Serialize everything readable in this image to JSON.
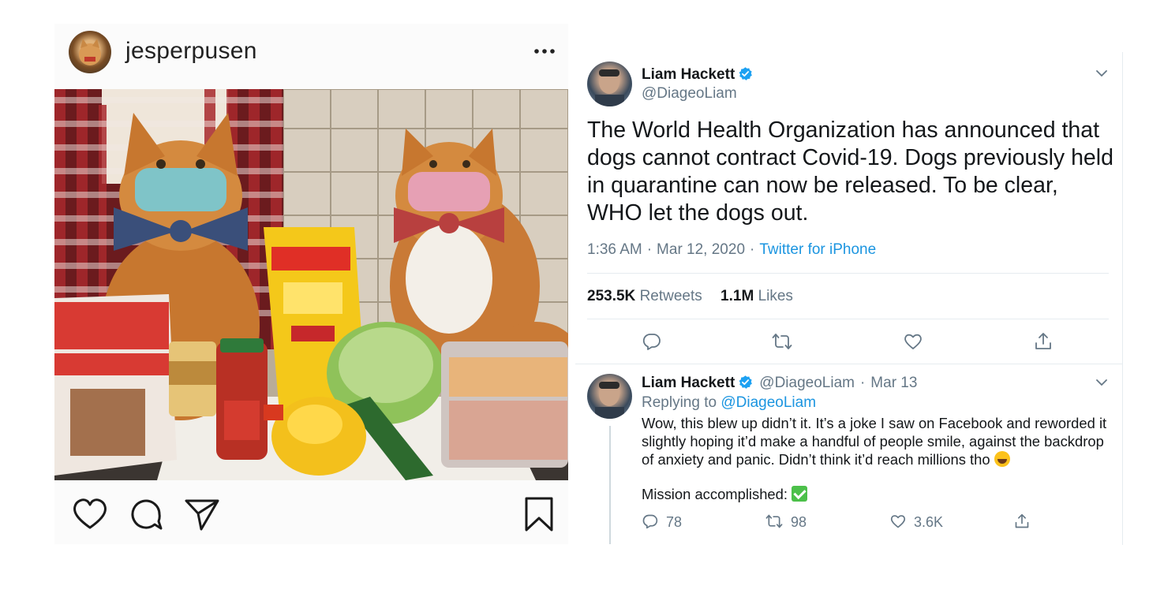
{
  "instagram": {
    "username": "jesperpusen"
  },
  "tweet": {
    "name": "Liam Hackett",
    "handle": "@DiageoLiam",
    "text": "The World Health Organization has announced that dogs cannot contract Covid-19. Dogs previously held in quarantine can now be released. To be clear, WHO let the dogs out.",
    "time": "1:36 AM",
    "date": "Mar 12, 2020",
    "source": "Twitter for iPhone",
    "retweets_count": "253.5K",
    "retweets_label": "Retweets",
    "likes_count": "1.1M",
    "likes_label": "Likes"
  },
  "reply": {
    "name": "Liam Hackett",
    "handle": "@DiageoLiam",
    "date": "Mar 13",
    "replying_label": "Replying to",
    "replying_to": "@DiageoLiam",
    "text": "Wow, this blew up didn’t it. It’s a joke I saw on Facebook and reworded it slightly hoping it’d make a handful of people smile, against the backdrop of anxiety and panic. Didn’t think it’d reach millions tho",
    "mission": "Mission accomplished:",
    "replies": "78",
    "retweets": "98",
    "likes": "3.6K"
  },
  "colors": {
    "twitter_blue": "#1b95e0",
    "verified_blue": "#1da1f2",
    "secondary_text": "#657786"
  },
  "icons": [
    "more-icon",
    "heart-icon",
    "comment-icon",
    "send-icon",
    "bookmark-icon",
    "verified-icon",
    "chevron-down-icon",
    "reply-icon",
    "retweet-icon",
    "like-icon",
    "share-icon"
  ]
}
